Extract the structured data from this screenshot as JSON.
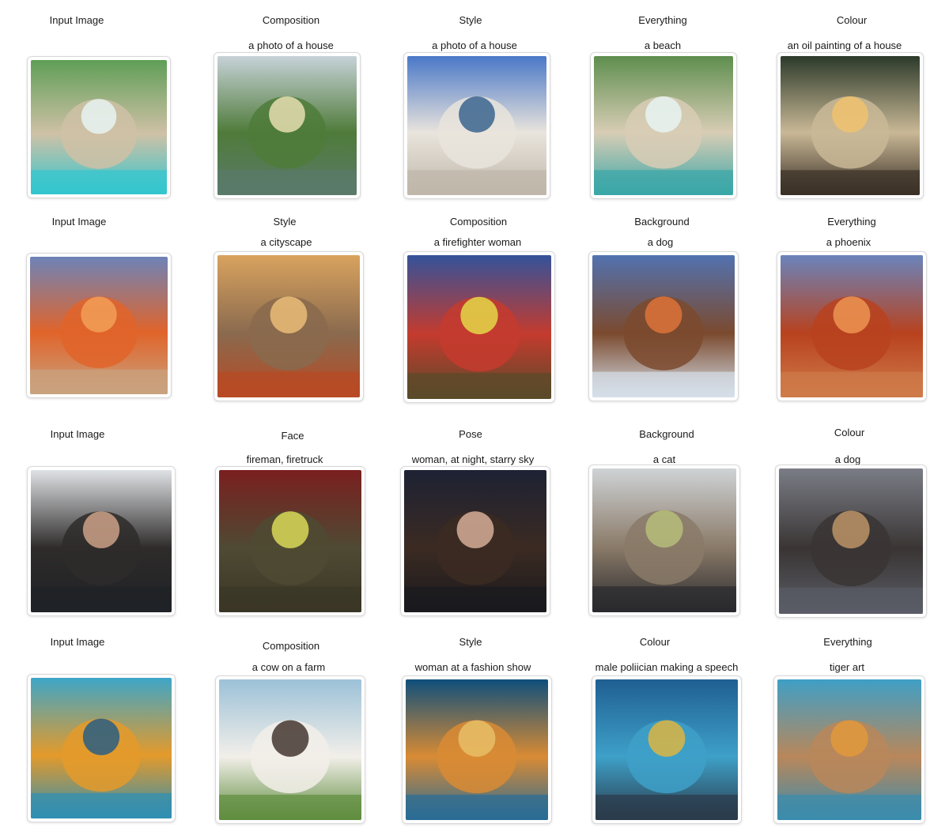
{
  "rows": [
    {
      "cells": [
        {
          "header": "Input Image",
          "prompt": "",
          "image": "aerial beach cove"
        },
        {
          "header": "Composition",
          "prompt": "a photo of a house",
          "image": "house on lake hillside"
        },
        {
          "header": "Style",
          "prompt": "a photo of a house",
          "image": "white townhouse"
        },
        {
          "header": "Everything",
          "prompt": "a beach",
          "image": "aerial beach cove variant"
        },
        {
          "header": "Colour",
          "prompt": "an oil painting of a house",
          "image": "house at dusk painting"
        }
      ]
    },
    {
      "cells": [
        {
          "header": "Input Image",
          "prompt": "",
          "image": "phoenix bird"
        },
        {
          "header": "Style",
          "prompt": "a cityscape",
          "image": "city aerial view"
        },
        {
          "header": "Composition",
          "prompt": "a firefighter woman",
          "image": "firefighter woman"
        },
        {
          "header": "Background",
          "prompt": "a dog",
          "image": "dog with wings"
        },
        {
          "header": "Everything",
          "prompt": "a phoenix",
          "image": "phoenix bird variant"
        }
      ]
    },
    {
      "cells": [
        {
          "header": "Input Image",
          "prompt": "",
          "image": "man with glasses portrait"
        },
        {
          "header": "Face",
          "prompt": "fireman, firetruck",
          "image": "fireman by firetruck"
        },
        {
          "header": "Pose",
          "prompt": "woman, at night, starry sky",
          "image": "woman under starry sky"
        },
        {
          "header": "Background",
          "prompt": "a cat",
          "image": "cat portrait"
        },
        {
          "header": "Colour",
          "prompt": "a dog",
          "image": "sitting dog"
        }
      ]
    },
    {
      "cells": [
        {
          "header": "Input Image",
          "prompt": "",
          "image": "ornate tiger sculpture"
        },
        {
          "header": "Composition",
          "prompt": "a cow on a farm",
          "image": "cow on farm"
        },
        {
          "header": "Style",
          "prompt": "woman at a fashion show",
          "image": "fashion show model"
        },
        {
          "header": "Colour",
          "prompt": "male poliician making a speech",
          "image": "politician speech"
        },
        {
          "header": "Everything",
          "prompt": "tiger art",
          "image": "tiger art sculpture"
        }
      ]
    }
  ],
  "colors": {
    "frame_border": "#d9d9d9",
    "text": "#1a1a1a"
  }
}
